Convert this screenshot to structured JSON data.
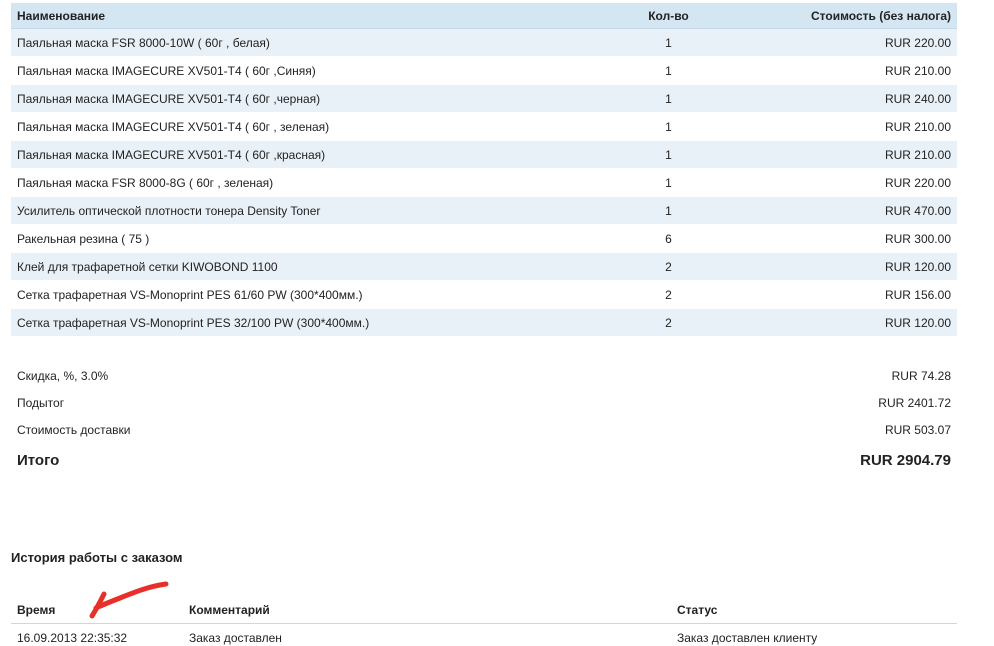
{
  "order": {
    "headers": {
      "name": "Наименование",
      "qty": "Кол-во",
      "cost": "Стоимость (без налога)"
    },
    "items": [
      {
        "name": "Паяльная маска FSR 8000-10W ( 60г , белая)",
        "qty": "1",
        "cost": "RUR 220.00"
      },
      {
        "name": "Паяльная маска IMAGECURE XV501-T4 ( 60г ,Синяя)",
        "qty": "1",
        "cost": "RUR 210.00"
      },
      {
        "name": "Паяльная маска IMAGECURE XV501-T4 ( 60г ,черная)",
        "qty": "1",
        "cost": "RUR 240.00"
      },
      {
        "name": "Паяльная маска IMAGECURE XV501-T4 ( 60г , зеленая)",
        "qty": "1",
        "cost": "RUR 210.00"
      },
      {
        "name": "Паяльная маска IMAGECURE XV501-T4 ( 60г ,красная)",
        "qty": "1",
        "cost": "RUR 210.00"
      },
      {
        "name": "Паяльная маска FSR 8000-8G ( 60г , зеленая)",
        "qty": "1",
        "cost": "RUR 220.00"
      },
      {
        "name": "Усилитель оптической плотности тонера Density Toner",
        "qty": "1",
        "cost": "RUR 470.00"
      },
      {
        "name": "Ракельная резина ( 75 )",
        "qty": "6",
        "cost": "RUR 300.00"
      },
      {
        "name": "Клей для трафаретной сетки KIWOBOND 1100",
        "qty": "2",
        "cost": "RUR 120.00"
      },
      {
        "name": "Сетка трафаретная VS-Monoprint PES 61/60 PW (300*400мм.)",
        "qty": "2",
        "cost": "RUR 156.00"
      },
      {
        "name": "Сетка трафаретная VS-Monoprint PES 32/100 PW (300*400мм.)",
        "qty": "2",
        "cost": "RUR 120.00"
      }
    ]
  },
  "totals": {
    "discount_label": "Скидка, %, 3.0%",
    "discount_value": "RUR 74.28",
    "subtotal_label": "Подытог",
    "subtotal_value": "RUR 2401.72",
    "shipping_label": "Стоимость доставки",
    "shipping_value": "RUR 503.07",
    "grand_label": "Итого",
    "grand_value": "RUR 2904.79"
  },
  "history": {
    "title": "История работы с заказом",
    "headers": {
      "time": "Время",
      "comment": "Комментарий",
      "status": "Статус"
    },
    "rows": [
      {
        "time": "16.09.2013 22:35:32",
        "comment": "Заказ доставлен",
        "status": "Заказ доставлен клиенту"
      }
    ]
  },
  "colors": {
    "header_bg": "#d5e6f3",
    "row_alt_bg": "#e9f1f8",
    "annotation_arrow": "#e8302a"
  }
}
